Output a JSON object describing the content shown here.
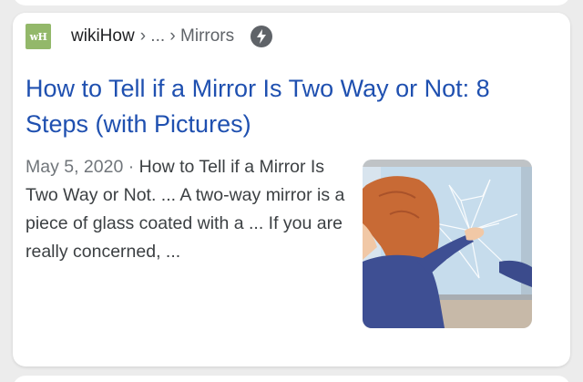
{
  "result": {
    "favicon_text": "wH",
    "site_name": "wikiHow",
    "breadcrumb": "› ... › Mirrors",
    "amp_icon": "lightning-bolt-icon",
    "title": "How to Tell if a Mirror Is Two Way or Not: 8 Steps (with Pictures)",
    "date": "May 5, 2020",
    "separator": " · ",
    "snippet": "How to Tell if a Mirror Is Two Way or Not. ... A two-way mirror is a piece of glass coated with a ... If you are really concerned, ...",
    "thumbnail": "woman-touching-cracked-mirror-illustration"
  },
  "colors": {
    "link": "#1f50b0",
    "favicon_bg": "#93b86a",
    "text": "#3c4043",
    "meta": "#70757a"
  }
}
